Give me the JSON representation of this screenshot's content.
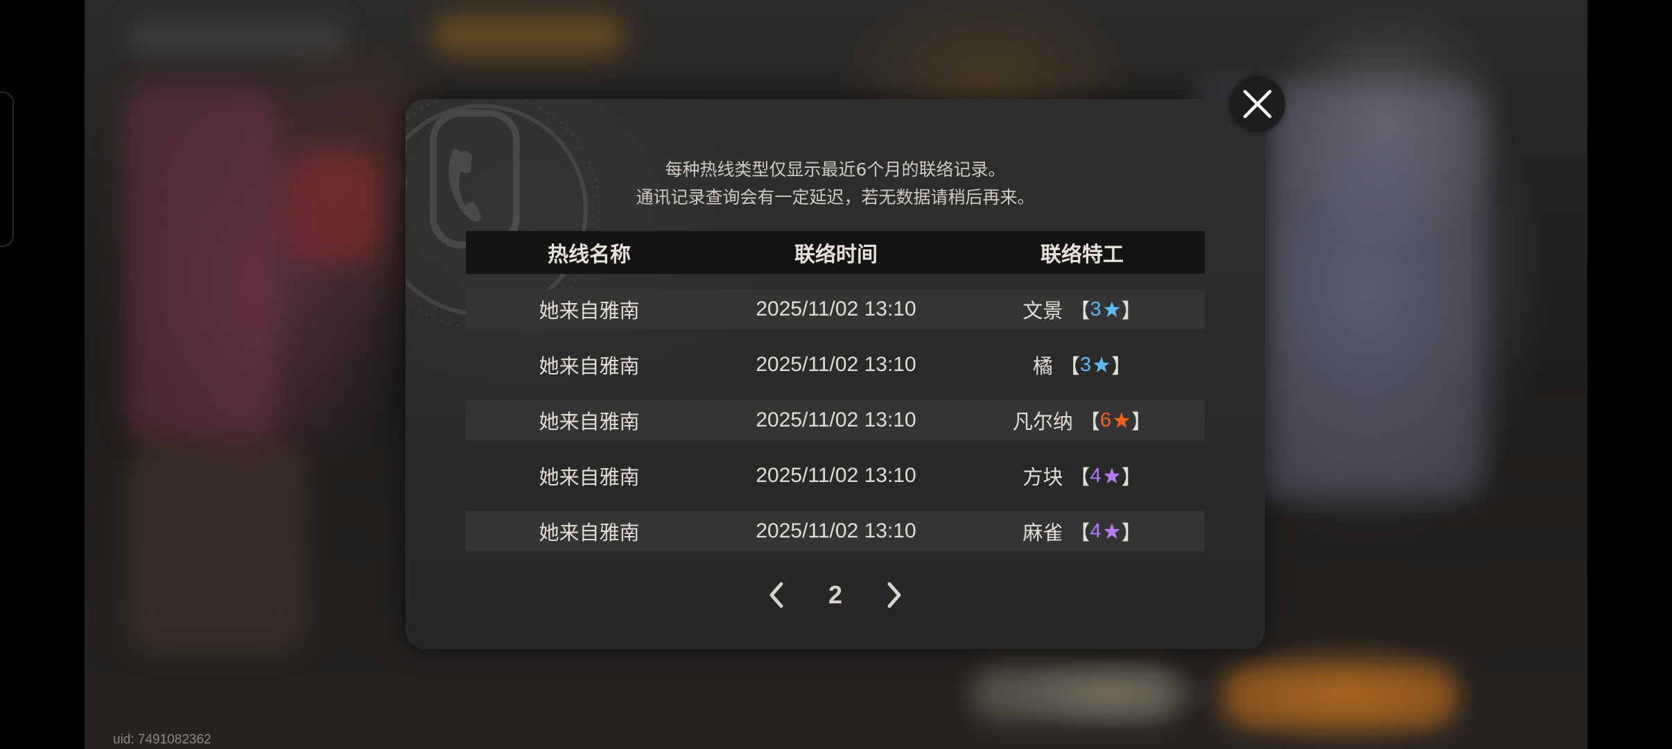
{
  "notice": {
    "line1": "每种热线类型仅显示最近6个月的联络记录。",
    "line2": "通讯记录查询会有一定延迟，若无数据请稍后再来。"
  },
  "table": {
    "headers": [
      "热线名称",
      "联络时间",
      "联络特工"
    ],
    "rows": [
      {
        "hotline": "她来自雅南",
        "time": "2025/11/02 13:10",
        "agent": "文景",
        "rank": "3",
        "rank_color": "#5fb8f0"
      },
      {
        "hotline": "她来自雅南",
        "time": "2025/11/02 13:10",
        "agent": "橘",
        "rank": "3",
        "rank_color": "#5fb8f0"
      },
      {
        "hotline": "她来自雅南",
        "time": "2025/11/02 13:10",
        "agent": "凡尔纳",
        "rank": "6",
        "rank_color": "#f0601e"
      },
      {
        "hotline": "她来自雅南",
        "time": "2025/11/02 13:10",
        "agent": "方块",
        "rank": "4",
        "rank_color": "#b27cf5"
      },
      {
        "hotline": "她来自雅南",
        "time": "2025/11/02 13:10",
        "agent": "麻雀",
        "rank": "4",
        "rank_color": "#b27cf5"
      }
    ]
  },
  "pagination": {
    "current_page": "2",
    "prev_icon": "chevron-left-icon",
    "next_icon": "chevron-right-icon"
  },
  "close_icon": "close-icon",
  "brackets": {
    "open": "【",
    "close": "】"
  },
  "uid": "uid: 7491082362"
}
